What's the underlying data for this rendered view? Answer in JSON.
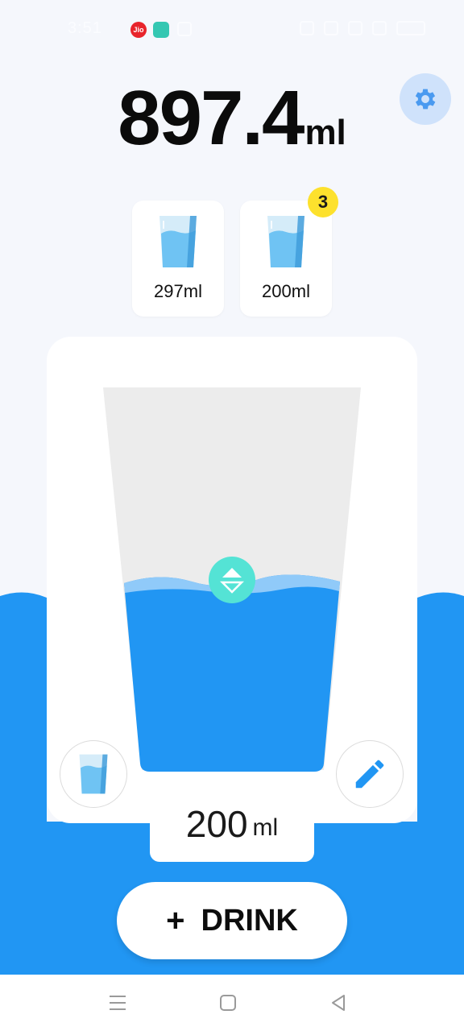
{
  "status_bar": {
    "time": "3:51",
    "carrier_badge": "Jio"
  },
  "daily_total": {
    "value": "897.4",
    "unit": "ml"
  },
  "cup_presets": [
    {
      "label": "297ml"
    },
    {
      "label": "200ml",
      "badge": "3"
    }
  ],
  "glass": {
    "fill_level": 0.55,
    "water_color": "#2196f3",
    "empty_color": "#ececec"
  },
  "selected_amount": {
    "value": "200",
    "unit": "ml"
  },
  "drink_button": {
    "plus": "+",
    "label": "DRINK"
  },
  "colors": {
    "accent": "#2196f3",
    "handle": "#54e3d5",
    "badge": "#fde12d",
    "settings_bg": "#cfe2fb"
  },
  "icons": [
    "settings-gear-icon",
    "water-glass-icon",
    "pencil-icon",
    "up-down-arrows-icon"
  ]
}
